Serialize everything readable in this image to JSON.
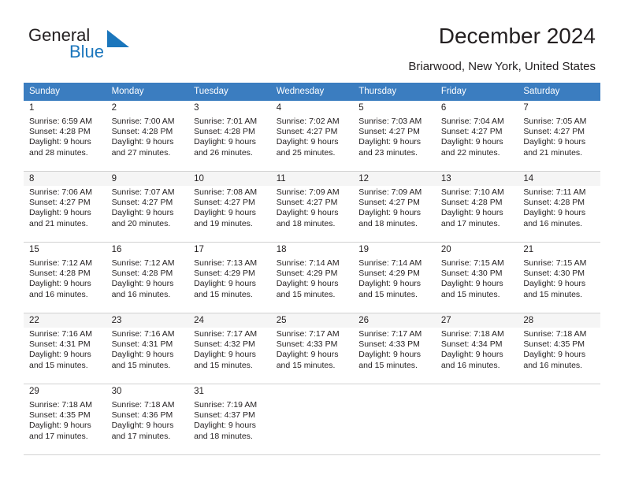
{
  "brand": {
    "word_one": "General",
    "word_two": "Blue",
    "mark": "blue-triangle-logo",
    "color_dark": "#231f20",
    "color_blue": "#1b76bc"
  },
  "header": {
    "title": "December 2024",
    "location": "Briarwood, New York, United States"
  },
  "theme": {
    "header_row_bg": "#3b7dc0",
    "header_row_text": "#ffffff",
    "shaded_row_bg": "#f5f5f5",
    "grid_line": "#d2d2d2",
    "text": "#231f20"
  },
  "calendar": {
    "weekday_headers": [
      "Sunday",
      "Monday",
      "Tuesday",
      "Wednesday",
      "Thursday",
      "Friday",
      "Saturday"
    ],
    "weeks": [
      [
        {
          "day": "1",
          "sunrise": "Sunrise: 6:59 AM",
          "sunset": "Sunset: 4:28 PM",
          "daylight_1": "Daylight: 9 hours",
          "daylight_2": "and 28 minutes."
        },
        {
          "day": "2",
          "sunrise": "Sunrise: 7:00 AM",
          "sunset": "Sunset: 4:28 PM",
          "daylight_1": "Daylight: 9 hours",
          "daylight_2": "and 27 minutes."
        },
        {
          "day": "3",
          "sunrise": "Sunrise: 7:01 AM",
          "sunset": "Sunset: 4:28 PM",
          "daylight_1": "Daylight: 9 hours",
          "daylight_2": "and 26 minutes."
        },
        {
          "day": "4",
          "sunrise": "Sunrise: 7:02 AM",
          "sunset": "Sunset: 4:27 PM",
          "daylight_1": "Daylight: 9 hours",
          "daylight_2": "and 25 minutes."
        },
        {
          "day": "5",
          "sunrise": "Sunrise: 7:03 AM",
          "sunset": "Sunset: 4:27 PM",
          "daylight_1": "Daylight: 9 hours",
          "daylight_2": "and 23 minutes."
        },
        {
          "day": "6",
          "sunrise": "Sunrise: 7:04 AM",
          "sunset": "Sunset: 4:27 PM",
          "daylight_1": "Daylight: 9 hours",
          "daylight_2": "and 22 minutes."
        },
        {
          "day": "7",
          "sunrise": "Sunrise: 7:05 AM",
          "sunset": "Sunset: 4:27 PM",
          "daylight_1": "Daylight: 9 hours",
          "daylight_2": "and 21 minutes."
        }
      ],
      [
        {
          "day": "8",
          "sunrise": "Sunrise: 7:06 AM",
          "sunset": "Sunset: 4:27 PM",
          "daylight_1": "Daylight: 9 hours",
          "daylight_2": "and 21 minutes."
        },
        {
          "day": "9",
          "sunrise": "Sunrise: 7:07 AM",
          "sunset": "Sunset: 4:27 PM",
          "daylight_1": "Daylight: 9 hours",
          "daylight_2": "and 20 minutes."
        },
        {
          "day": "10",
          "sunrise": "Sunrise: 7:08 AM",
          "sunset": "Sunset: 4:27 PM",
          "daylight_1": "Daylight: 9 hours",
          "daylight_2": "and 19 minutes."
        },
        {
          "day": "11",
          "sunrise": "Sunrise: 7:09 AM",
          "sunset": "Sunset: 4:27 PM",
          "daylight_1": "Daylight: 9 hours",
          "daylight_2": "and 18 minutes."
        },
        {
          "day": "12",
          "sunrise": "Sunrise: 7:09 AM",
          "sunset": "Sunset: 4:27 PM",
          "daylight_1": "Daylight: 9 hours",
          "daylight_2": "and 18 minutes."
        },
        {
          "day": "13",
          "sunrise": "Sunrise: 7:10 AM",
          "sunset": "Sunset: 4:28 PM",
          "daylight_1": "Daylight: 9 hours",
          "daylight_2": "and 17 minutes."
        },
        {
          "day": "14",
          "sunrise": "Sunrise: 7:11 AM",
          "sunset": "Sunset: 4:28 PM",
          "daylight_1": "Daylight: 9 hours",
          "daylight_2": "and 16 minutes."
        }
      ],
      [
        {
          "day": "15",
          "sunrise": "Sunrise: 7:12 AM",
          "sunset": "Sunset: 4:28 PM",
          "daylight_1": "Daylight: 9 hours",
          "daylight_2": "and 16 minutes."
        },
        {
          "day": "16",
          "sunrise": "Sunrise: 7:12 AM",
          "sunset": "Sunset: 4:28 PM",
          "daylight_1": "Daylight: 9 hours",
          "daylight_2": "and 16 minutes."
        },
        {
          "day": "17",
          "sunrise": "Sunrise: 7:13 AM",
          "sunset": "Sunset: 4:29 PM",
          "daylight_1": "Daylight: 9 hours",
          "daylight_2": "and 15 minutes."
        },
        {
          "day": "18",
          "sunrise": "Sunrise: 7:14 AM",
          "sunset": "Sunset: 4:29 PM",
          "daylight_1": "Daylight: 9 hours",
          "daylight_2": "and 15 minutes."
        },
        {
          "day": "19",
          "sunrise": "Sunrise: 7:14 AM",
          "sunset": "Sunset: 4:29 PM",
          "daylight_1": "Daylight: 9 hours",
          "daylight_2": "and 15 minutes."
        },
        {
          "day": "20",
          "sunrise": "Sunrise: 7:15 AM",
          "sunset": "Sunset: 4:30 PM",
          "daylight_1": "Daylight: 9 hours",
          "daylight_2": "and 15 minutes."
        },
        {
          "day": "21",
          "sunrise": "Sunrise: 7:15 AM",
          "sunset": "Sunset: 4:30 PM",
          "daylight_1": "Daylight: 9 hours",
          "daylight_2": "and 15 minutes."
        }
      ],
      [
        {
          "day": "22",
          "sunrise": "Sunrise: 7:16 AM",
          "sunset": "Sunset: 4:31 PM",
          "daylight_1": "Daylight: 9 hours",
          "daylight_2": "and 15 minutes."
        },
        {
          "day": "23",
          "sunrise": "Sunrise: 7:16 AM",
          "sunset": "Sunset: 4:31 PM",
          "daylight_1": "Daylight: 9 hours",
          "daylight_2": "and 15 minutes."
        },
        {
          "day": "24",
          "sunrise": "Sunrise: 7:17 AM",
          "sunset": "Sunset: 4:32 PM",
          "daylight_1": "Daylight: 9 hours",
          "daylight_2": "and 15 minutes."
        },
        {
          "day": "25",
          "sunrise": "Sunrise: 7:17 AM",
          "sunset": "Sunset: 4:33 PM",
          "daylight_1": "Daylight: 9 hours",
          "daylight_2": "and 15 minutes."
        },
        {
          "day": "26",
          "sunrise": "Sunrise: 7:17 AM",
          "sunset": "Sunset: 4:33 PM",
          "daylight_1": "Daylight: 9 hours",
          "daylight_2": "and 15 minutes."
        },
        {
          "day": "27",
          "sunrise": "Sunrise: 7:18 AM",
          "sunset": "Sunset: 4:34 PM",
          "daylight_1": "Daylight: 9 hours",
          "daylight_2": "and 16 minutes."
        },
        {
          "day": "28",
          "sunrise": "Sunrise: 7:18 AM",
          "sunset": "Sunset: 4:35 PM",
          "daylight_1": "Daylight: 9 hours",
          "daylight_2": "and 16 minutes."
        }
      ],
      [
        {
          "day": "29",
          "sunrise": "Sunrise: 7:18 AM",
          "sunset": "Sunset: 4:35 PM",
          "daylight_1": "Daylight: 9 hours",
          "daylight_2": "and 17 minutes."
        },
        {
          "day": "30",
          "sunrise": "Sunrise: 7:18 AM",
          "sunset": "Sunset: 4:36 PM",
          "daylight_1": "Daylight: 9 hours",
          "daylight_2": "and 17 minutes."
        },
        {
          "day": "31",
          "sunrise": "Sunrise: 7:19 AM",
          "sunset": "Sunset: 4:37 PM",
          "daylight_1": "Daylight: 9 hours",
          "daylight_2": "and 18 minutes."
        },
        {
          "day": "",
          "sunrise": "",
          "sunset": "",
          "daylight_1": "",
          "daylight_2": ""
        },
        {
          "day": "",
          "sunrise": "",
          "sunset": "",
          "daylight_1": "",
          "daylight_2": ""
        },
        {
          "day": "",
          "sunrise": "",
          "sunset": "",
          "daylight_1": "",
          "daylight_2": ""
        },
        {
          "day": "",
          "sunrise": "",
          "sunset": "",
          "daylight_1": "",
          "daylight_2": ""
        }
      ]
    ]
  }
}
